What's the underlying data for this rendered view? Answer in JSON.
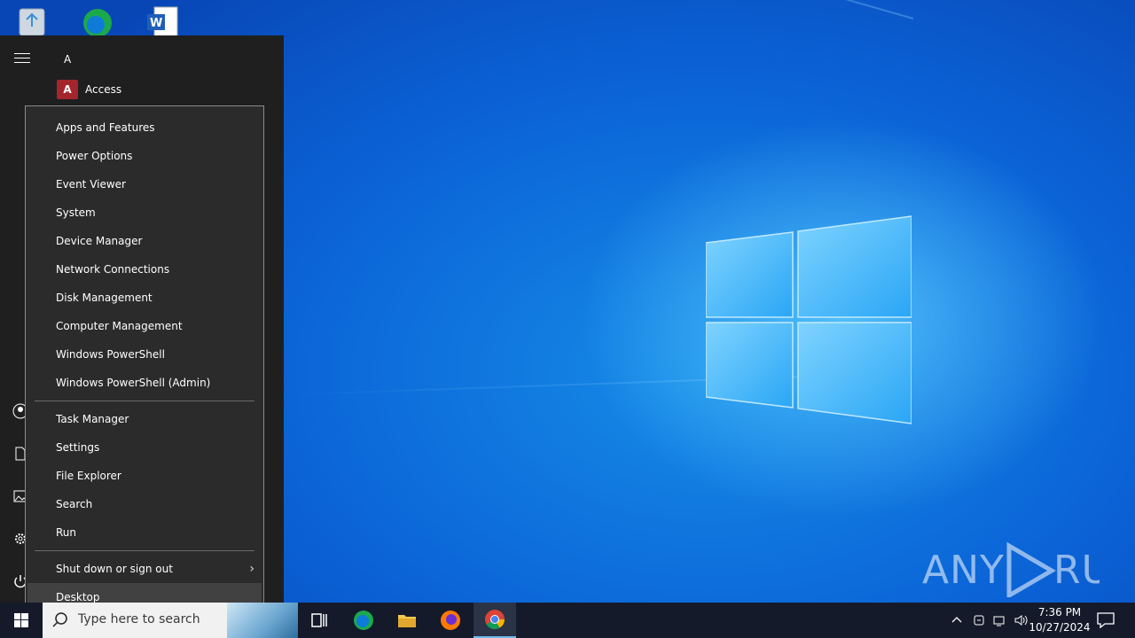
{
  "start_menu": {
    "section_letter": "A",
    "apps": [
      {
        "label": "Access",
        "icon": "access-icon"
      }
    ]
  },
  "context_menu": {
    "group1": [
      "Apps and Features",
      "Power Options",
      "Event Viewer",
      "System",
      "Device Manager",
      "Network Connections",
      "Disk Management",
      "Computer Management",
      "Windows PowerShell",
      "Windows PowerShell (Admin)"
    ],
    "group2": [
      "Task Manager",
      "Settings",
      "File Explorer",
      "Search",
      "Run"
    ],
    "group3": [
      {
        "label": "Shut down or sign out",
        "has_submenu": true
      },
      {
        "label": "Desktop",
        "highlighted": true
      }
    ]
  },
  "taskbar": {
    "search_placeholder": "Type here to search",
    "pinned": [
      "task-view-icon",
      "edge-icon",
      "file-explorer-icon",
      "firefox-icon",
      "chrome-icon"
    ],
    "active": "chrome-icon"
  },
  "tray": {
    "time": "7:36 PM",
    "date": "10/27/2024"
  },
  "watermark": "ANY RUN",
  "colors": {
    "menu_bg": "#2b2b2b",
    "start_bg": "#1f1f1f",
    "taskbar_bg": "#141a2a",
    "highlight": "#414141"
  }
}
